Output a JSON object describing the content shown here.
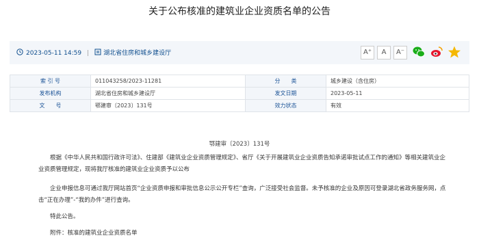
{
  "page_title": "关于公布核准的建筑业企业资质名单的公告",
  "meta": {
    "datetime": "2023-05-11 14:59",
    "separator": "|",
    "source": "湖北省住房和城乡建设厅",
    "font_large": "A⁺",
    "font_medium": "A",
    "font_small": "A⁻",
    "colors": {
      "link": "#0e4d8d",
      "wechat": "#1aad19",
      "weibo": "#e6162d",
      "favorite": "#f5b800"
    }
  },
  "info_table": {
    "index_label": "索 引 号",
    "index_value": "011043258/2023-11281",
    "category_label": "分　　类",
    "category_value": "城乡建设（含住房）",
    "org_label": "发布机构",
    "org_value": "湖北省住房和城乡建设厅",
    "date_label": "发文日期",
    "date_value": "2023-05-11",
    "docno_label": "文　　号",
    "docno_value": "鄂建审〔2023〕131号",
    "status_label": "效力状态",
    "status_value": "有效"
  },
  "document_number": "鄂建审〔2023〕131号",
  "body": {
    "p1": "根据《中华人民共和国行政许可法》、住建部《建筑业企业资质管理规定》、省厅《关于开展建筑业企业资质告知承诺审批试点工作的通知》等相关建筑业企业资质管理规定，现将我厅核准的建筑业企业资质予以公布",
    "p2": "企业申报信息可通过我厅网站首页“企业资质申报和审批信息公示公开专栏”查询，广泛接受社会监督。未予核准的企业及原因可登录湖北省政务服务网，点击“正在办理”-“我的办件”进行查询。",
    "p3": "特此公告。",
    "p4": "附件：核准的建筑业企业资质名单"
  }
}
